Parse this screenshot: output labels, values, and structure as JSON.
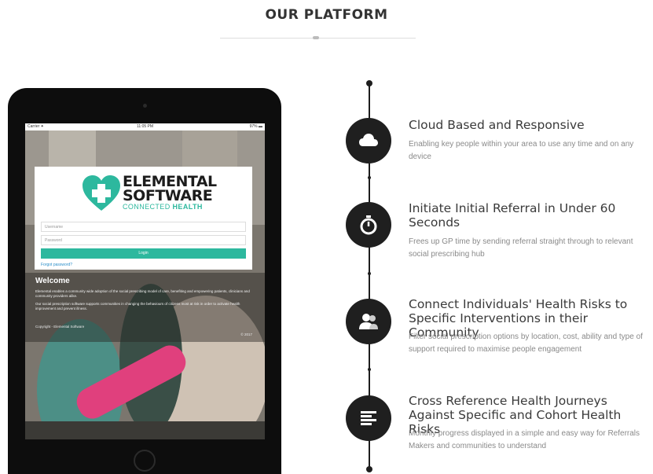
{
  "section": {
    "title": "OUR PLATFORM"
  },
  "tablet": {
    "status_bar": {
      "carrier": "Carrier ✦",
      "time": "11:05 PM",
      "battery": "97% ▬"
    },
    "login": {
      "logo_title_line1": "ELEMENTAL",
      "logo_title_line2": "SOFTWARE",
      "logo_tagline_a": "CONNECTED",
      "logo_tagline_b": "HEALTH",
      "username_placeholder": "Username",
      "password_placeholder": "Password",
      "login_label": "Login",
      "forgot_label": "Forgot password?"
    },
    "welcome": {
      "title": "Welcome",
      "paragraph1": "Elemental enables a community wide adoption of the social prescribing model of care, benefiting and empowering patients, clinicians and community providers alike.",
      "paragraph2": "Our social prescription software supports communities in changing the behaviours of citizens most at risk in order to activate health improvement and prevent illness.",
      "copyright": "Copyright - Elemental Software",
      "year": "© 2017"
    }
  },
  "features": [
    {
      "icon": "cloud-icon",
      "title": "Cloud Based and Responsive",
      "desc": "Enabling key people within your area to use any time and on any device"
    },
    {
      "icon": "stopwatch-icon",
      "title": "Initiate Initial Referral in Under 60 Seconds",
      "desc": "Frees up GP time by sending referral straight through to relevant social prescribing hub"
    },
    {
      "icon": "people-icon",
      "title": "Connect Individuals' Health Risks to Specific Interventions in their Community",
      "desc": "Filter social prescription options by location, cost, ability and type of support required to maximise people engagement"
    },
    {
      "icon": "text-lines-icon",
      "title": "Cross Reference Health Journeys Against Specific and Cohort Health Risks",
      "desc": "Monthly progress displayed in a simple and easy way for Referrals Makers and communities to understand"
    }
  ],
  "colors": {
    "accent": "#2db89e",
    "circle": "#1f1f1f",
    "text": "#3a3a3a",
    "muted": "#8a8a8a"
  }
}
